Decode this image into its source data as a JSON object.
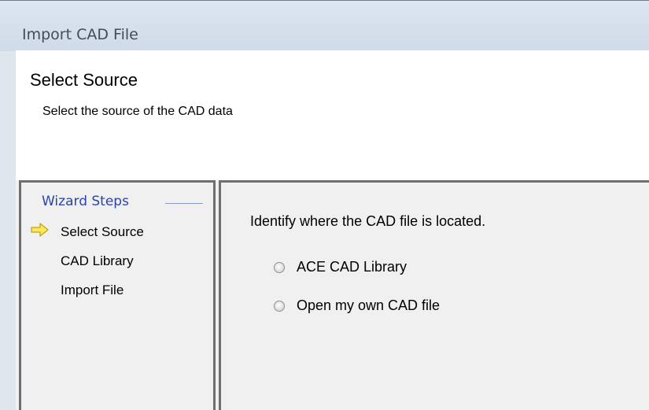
{
  "window": {
    "title": "Import CAD File"
  },
  "header": {
    "title": "Select Source",
    "subtitle": "Select the source of the CAD data"
  },
  "wizard_steps": {
    "heading": "Wizard Steps",
    "current_step_icon": "arrow-right-icon",
    "steps": [
      {
        "label": "Select Source",
        "current": true
      },
      {
        "label": "CAD Library",
        "current": false
      },
      {
        "label": "Import File",
        "current": false
      }
    ]
  },
  "content": {
    "question": "Identify where the CAD file is located.",
    "options": [
      {
        "label": "ACE CAD Library",
        "selected": false
      },
      {
        "label": "Open my own CAD file",
        "selected": false
      }
    ]
  },
  "colors": {
    "steps_heading": "#2c44a7",
    "arrow_fill": "#f7e95a",
    "arrow_stroke": "#c8a21a",
    "panel_bg": "#f0f0f0",
    "panel_border": "#6e6e6e"
  }
}
